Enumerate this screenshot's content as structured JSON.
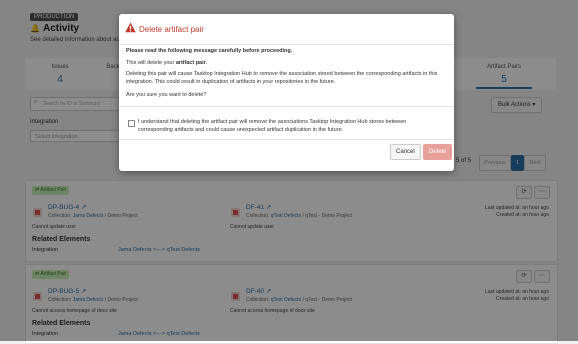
{
  "header": {
    "env_badge": "PRODUCTION",
    "title": "Activity",
    "description": "See detailed information about act"
  },
  "tabs": [
    {
      "label": "Issues",
      "count": "4"
    },
    {
      "label": "Back"
    },
    {
      "label": "Artifact Pairs",
      "count": "5"
    }
  ],
  "filters": {
    "search_placeholder": "Search by ID or Summary",
    "integration_label": "Integration",
    "integration_placeholder": "Select integration"
  },
  "toolbar": {
    "bulk_actions": "Bulk Actions ▾"
  },
  "pager": {
    "info": "5 of 5",
    "prev": "Previous",
    "page": "1",
    "next": "Next"
  },
  "cards": [
    {
      "badge": "⇄ Artifact Pair",
      "left": {
        "id": "DP-BUG-4 ↗",
        "collection_label": "Collection:",
        "collection_link": "Jama Defects",
        "collection_rest": "/ Demo Project",
        "note": "Cannot update user"
      },
      "right": {
        "id": "DF-41 ↗",
        "collection_label": "Collection:",
        "collection_link": "qTest Defects",
        "collection_rest": "/ qTest - Demo Project",
        "note": "Cannot update user"
      },
      "updated": "Last updated at: an hour ago",
      "created": "Created at: an hour ago",
      "related_title": "Related Elements",
      "related_label": "Integration",
      "related_link": "Jama Defects <---> qTest Defects"
    },
    {
      "badge": "⇄ Artifact Pair",
      "left": {
        "id": "DP-BUG-5 ↗",
        "collection_label": "Collection:",
        "collection_link": "Jama Defects",
        "collection_rest": "/ Demo Project",
        "note": "Cannot access homepage of docs site"
      },
      "right": {
        "id": "DF-40 ↗",
        "collection_label": "Collection:",
        "collection_link": "qTest Defects",
        "collection_rest": "/ qTest - Demo Project",
        "note": "Cannot access homepage of docs site"
      },
      "updated": "Last updated at: an hour ago",
      "created": "Created at: an hour ago",
      "related_title": "Related Elements",
      "related_label": "Integration",
      "related_link": "Jama Defects <---> qTest Defects"
    }
  ],
  "modal": {
    "title": "Delete artifact pair",
    "lead": "Please read the following message carefully before proceeding.",
    "line1_pre": "This will delete your ",
    "line1_bold": "artifact pair",
    "line1_post": ".",
    "line2": "Deleting this pair will cause Tasktop Integration Hub to remove the association stored between the corresponding artifacts in this integration. This could result in duplication of artifacts in your repositories in the future.",
    "line3": "Are you sure you want to delete?",
    "checkbox_text": "I understand that deleting the artifact pair will remove the associations Tasktop Integration Hub stores between corresponding artifacts and could cause unexpected artifact duplication in the future.",
    "cancel": "Cancel",
    "delete": "Delete",
    "title_color": "#c0392b"
  }
}
